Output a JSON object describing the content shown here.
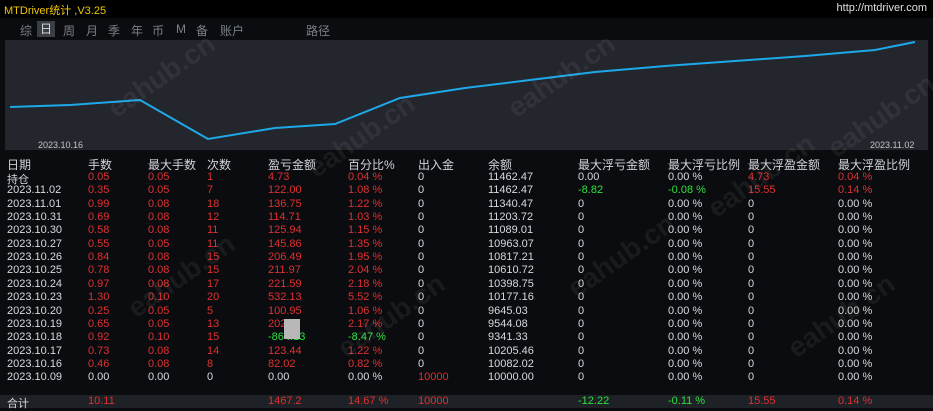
{
  "app": {
    "title": "MTDriver统计 ,V3.25",
    "url": "http://mtdriver.com"
  },
  "tabs": [
    "综",
    "日",
    "周",
    "月",
    "季",
    "年",
    "币",
    "M",
    "备",
    "账户",
    "路径"
  ],
  "active_tab": "日",
  "chart": {
    "start_date": "2023.10.16",
    "end_date": "2023.11.02",
    "line_color": "#1fa8e8"
  },
  "table": {
    "headers": [
      "日期",
      "手数",
      "最大手数",
      "次数",
      "盈亏金额",
      "百分比%",
      "出入金",
      "余额",
      "最大浮亏金额",
      "最大浮亏比例",
      "最大浮盈金额",
      "最大浮盈比例"
    ],
    "rows": [
      [
        "持仓",
        "0.05",
        "0.05",
        "1",
        "4.73",
        "0.04 %",
        "0",
        "11462.47",
        "0.00",
        "0.00 %",
        "4.73",
        "0.04 %"
      ],
      [
        "2023.11.02",
        "0.35",
        "0.05",
        "7",
        "122.00",
        "1.08 %",
        "0",
        "11462.47",
        "-8.82",
        "-0.08 %",
        "15.55",
        "0.14 %"
      ],
      [
        "2023.11.01",
        "0.99",
        "0.08",
        "18",
        "136.75",
        "1.22 %",
        "0",
        "11340.47",
        "0",
        "0.00 %",
        "0",
        "0.00 %"
      ],
      [
        "2023.10.31",
        "0.69",
        "0.08",
        "12",
        "114.71",
        "1.03 %",
        "0",
        "11203.72",
        "0",
        "0.00 %",
        "0",
        "0.00 %"
      ],
      [
        "2023.10.30",
        "0.58",
        "0.08",
        "11",
        "125.94",
        "1.15 %",
        "0",
        "11089.01",
        "0",
        "0.00 %",
        "0",
        "0.00 %"
      ],
      [
        "2023.10.27",
        "0.55",
        "0.05",
        "11",
        "145.86",
        "1.35 %",
        "0",
        "10963.07",
        "0",
        "0.00 %",
        "0",
        "0.00 %"
      ],
      [
        "2023.10.26",
        "0.84",
        "0.08",
        "15",
        "206.49",
        "1.95 %",
        "0",
        "10817.21",
        "0",
        "0.00 %",
        "0",
        "0.00 %"
      ],
      [
        "2023.10.25",
        "0.78",
        "0.08",
        "15",
        "211.97",
        "2.04 %",
        "0",
        "10610.72",
        "0",
        "0.00 %",
        "0",
        "0.00 %"
      ],
      [
        "2023.10.24",
        "0.97",
        "0.08",
        "17",
        "221.59",
        "2.18 %",
        "0",
        "10398.75",
        "0",
        "0.00 %",
        "0",
        "0.00 %"
      ],
      [
        "2023.10.23",
        "1.30",
        "0.10",
        "20",
        "532.13",
        "5.52 %",
        "0",
        "10177.16",
        "0",
        "0.00 %",
        "0",
        "0.00 %"
      ],
      [
        "2023.10.20",
        "0.25",
        "0.05",
        "5",
        "100.95",
        "1.06 %",
        "0",
        "9645.03",
        "0",
        "0.00 %",
        "0",
        "0.00 %"
      ],
      [
        "2023.10.19",
        "0.65",
        "0.05",
        "13",
        "202",
        "2.17 %",
        "0",
        "9544.08",
        "0",
        "0.00 %",
        "0",
        "0.00 %"
      ],
      [
        "2023.10.18",
        "0.92",
        "0.10",
        "15",
        "-864.13",
        "-8.47 %",
        "0",
        "9341.33",
        "0",
        "0.00 %",
        "0",
        "0.00 %"
      ],
      [
        "2023.10.17",
        "0.73",
        "0.08",
        "14",
        "123.44",
        "1.22 %",
        "0",
        "10205.46",
        "0",
        "0.00 %",
        "0",
        "0.00 %"
      ],
      [
        "2023.10.16",
        "0.46",
        "0.08",
        "8",
        "82.02",
        "0.82 %",
        "0",
        "10082.02",
        "0",
        "0.00 %",
        "0",
        "0.00 %"
      ],
      [
        "2023.10.09",
        "0.00",
        "0.00",
        "0",
        "0.00",
        "0.00 %",
        "10000",
        "10000.00",
        "0",
        "0.00 %",
        "0",
        "0.00 %"
      ]
    ],
    "total": [
      "合计",
      "10.11",
      "",
      "",
      "1467.2",
      "14.67 %",
      "10000",
      "",
      "-12.22",
      "-0.11 %",
      "15.55",
      "0.14 %"
    ]
  },
  "watermark": "eahub.cn"
}
